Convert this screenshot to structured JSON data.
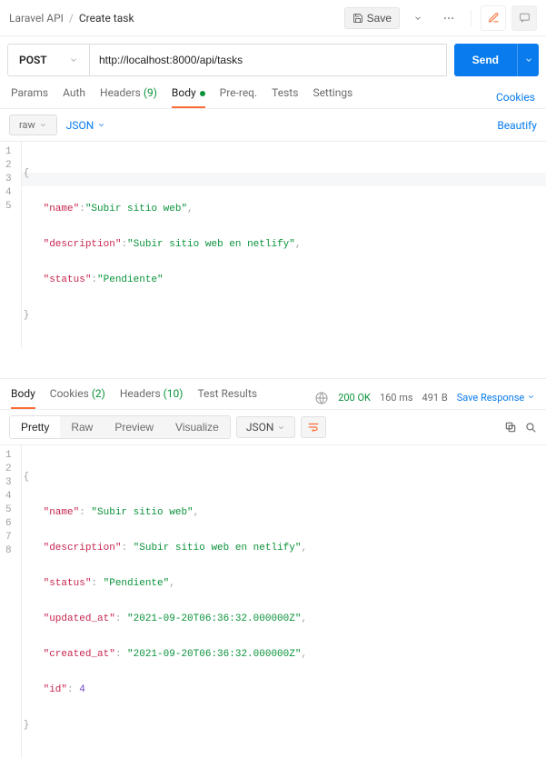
{
  "top": {
    "collection": "Laravel API",
    "separator": "/",
    "request": "Create task",
    "save": "Save"
  },
  "request": {
    "method": "POST",
    "url": "http://localhost:8000/api/tasks",
    "send": "Send"
  },
  "tabs": {
    "params": "Params",
    "auth": "Auth",
    "headers": "Headers",
    "headers_count": "(9)",
    "body": "Body",
    "prereq": "Pre-req.",
    "tests": "Tests",
    "settings": "Settings",
    "cookies": "Cookies"
  },
  "sub": {
    "raw": "raw",
    "format": "JSON",
    "beautify": "Beautify"
  },
  "req_body": {
    "name_key": "\"name\"",
    "name_val": "\"Subir sitio web\"",
    "desc_key": "\"description\"",
    "desc_val": "\"Subir sitio web en netlify\"",
    "status_key": "\"status\"",
    "status_val": "\"Pendiente\""
  },
  "resp_tabs": {
    "body": "Body",
    "cookies": "Cookies",
    "cookies_count": "(2)",
    "headers": "Headers",
    "headers_count": "(10)",
    "tests": "Test Results"
  },
  "status": {
    "code": "200 OK",
    "time": "160 ms",
    "size": "491 B",
    "save": "Save Response"
  },
  "segs": {
    "pretty": "Pretty",
    "raw": "Raw",
    "preview": "Preview",
    "visualize": "Visualize",
    "format": "JSON"
  },
  "resp_body": {
    "name_key": "\"name\"",
    "name_val": "\"Subir sitio web\"",
    "desc_key": "\"description\"",
    "desc_val": "\"Subir sitio web en netlify\"",
    "status_key": "\"status\"",
    "status_val": "\"Pendiente\"",
    "updated_key": "\"updated_at\"",
    "updated_val": "\"2021-09-20T06:36:32.000000Z\"",
    "created_key": "\"created_at\"",
    "created_val": "\"2021-09-20T06:36:32.000000Z\"",
    "id_key": "\"id\"",
    "id_val": "4"
  }
}
